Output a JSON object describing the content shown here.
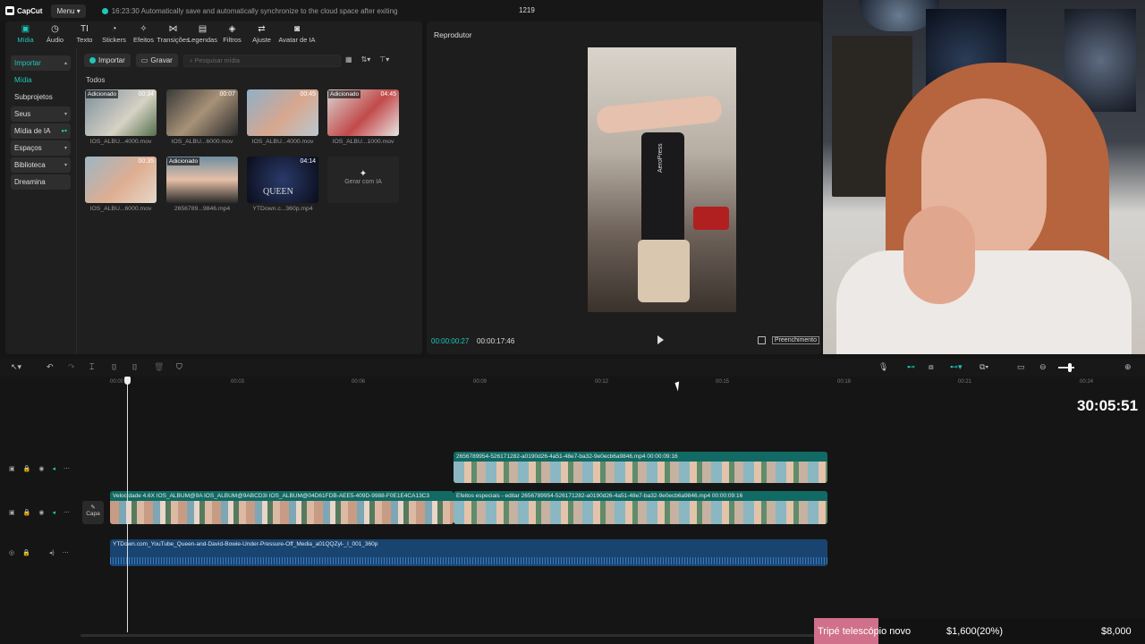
{
  "app": {
    "name": "CapCut",
    "menu": "Menu",
    "autosave": "16:23:30 Automatically save and automatically synchronize to the cloud space after exiting",
    "project": "1219"
  },
  "tabs": [
    {
      "label": "Mídia",
      "icon": "media-icon",
      "glyph": "▣"
    },
    {
      "label": "Áudio",
      "icon": "audio-icon",
      "glyph": "◷"
    },
    {
      "label": "Texto",
      "icon": "text-icon",
      "glyph": "TI"
    },
    {
      "label": "Stickers",
      "icon": "sticker-icon",
      "glyph": "◔"
    },
    {
      "label": "Efeitos",
      "icon": "effects-icon",
      "glyph": "✧"
    },
    {
      "label": "Transições",
      "icon": "transition-icon",
      "glyph": "⋈"
    },
    {
      "label": "Legendas",
      "icon": "captions-icon",
      "glyph": "▤"
    },
    {
      "label": "Filtros",
      "icon": "filter-icon",
      "glyph": "◈"
    },
    {
      "label": "Ajuste",
      "icon": "adjust-icon",
      "glyph": "⇄"
    },
    {
      "label": "Avatar de IA",
      "icon": "avatar-icon",
      "glyph": "◙"
    }
  ],
  "sidebar": [
    "Importar",
    "Mídia",
    "Subprojetos",
    "Seus",
    "Mídia de IA",
    "Espaços",
    "Biblioteca",
    "Dreamina"
  ],
  "toolbar": {
    "import": "Importar",
    "record": "Gravar",
    "search_placeholder": "Pesquisar mídia"
  },
  "section": "Todos",
  "media": [
    {
      "name": "IOS_ALBU...4000.mov",
      "duration": "00:34",
      "added": "Adicionado"
    },
    {
      "name": "IOS_ALBU...6000.mov",
      "duration": "00:07",
      "added": ""
    },
    {
      "name": "IOS_ALBU...4000.mov",
      "duration": "00:45",
      "added": ""
    },
    {
      "name": "IOS_ALBU...1000.mov",
      "duration": "04:45",
      "added": "Adicionado"
    },
    {
      "name": "IOS_ALBU...6000.mov",
      "duration": "00:35",
      "added": ""
    },
    {
      "name": "2656789...9846.mp4",
      "duration": "",
      "added": "Adicionado"
    },
    {
      "name": "YTDown.c...360p.mp4",
      "duration": "04:14",
      "added": ""
    }
  ],
  "generate": "Gerar com IA",
  "player": {
    "title": "Reprodutor",
    "current": "00:00:00:27",
    "total": "00:00:17:46",
    "fill": "Preenchimento",
    "video_label": "AeroPress"
  },
  "ruler": [
    "00:00",
    "00:03",
    "00:06",
    "00:09",
    "00:12",
    "00:15",
    "00:18",
    "00:21",
    "00:24"
  ],
  "clock": "30:05:51",
  "capa": "Capa",
  "clips": {
    "overlay": "2656789954-526171282-a0190d26-4a51-48e7-ba32-9e0ecb6a9846.mp4   00:00:09:16",
    "main_a": "Velocidade 4.6X   IOS_ALBUM@9A   IOS_ALBUM@9ABCD3I   IOS_ALBUM@04D61FDB-AEE5-409D-9988-F0E1E4CA13C3",
    "main_b": "Efeitos especiais - editar   2656789954-526171282-a0190d26-4a51-48e7-ba32-9e0ecb6a9846.mp4   00:00:09:16",
    "audio": "YTDown.com_YouTube_Queen-and-David-Bowie-Under-Pressure-Off_Media_a01QQZyl-_I_001_360p"
  },
  "queen_label": "QUEEN",
  "stream": {
    "label": "Tripé telescópio novo",
    "value1": "$1,600(20%)",
    "value2": "$8,000"
  },
  "colors": {
    "accent": "#1ec7b8",
    "clip": "#116a63",
    "audio": "#1a4470"
  }
}
